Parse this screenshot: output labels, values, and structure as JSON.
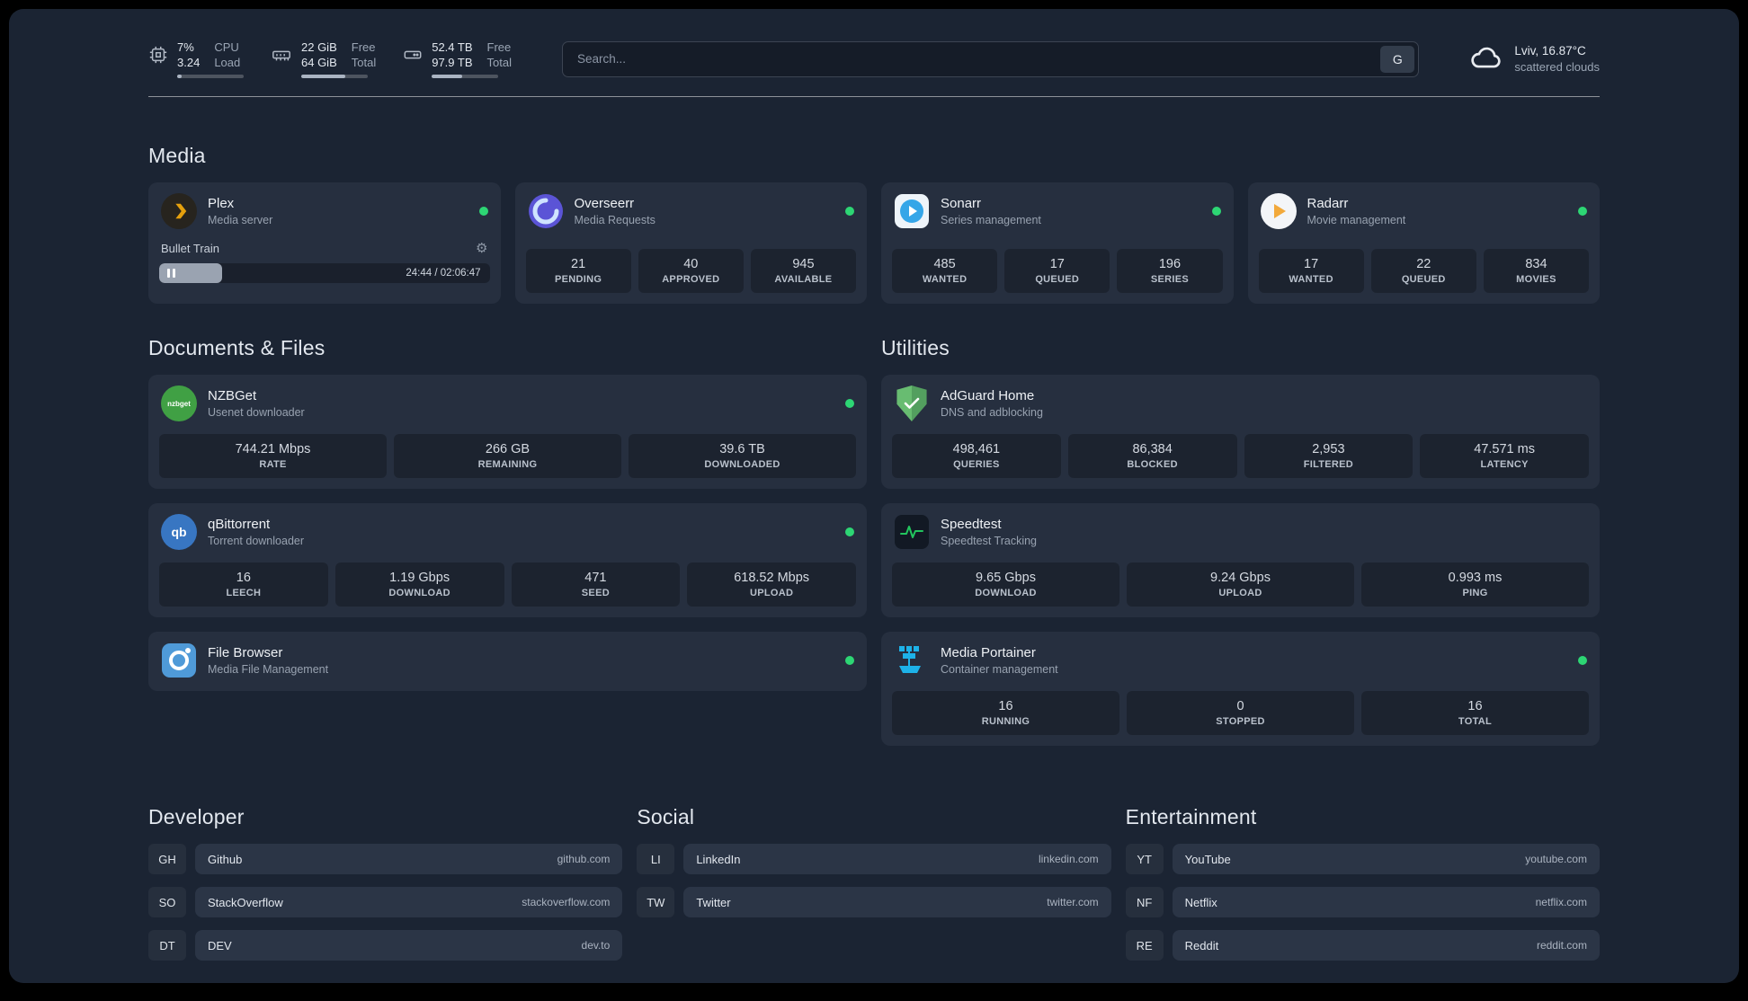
{
  "topbar": {
    "resources": [
      {
        "icon": "cpu-icon",
        "value_top": "7%",
        "value_bottom": "3.24",
        "label_top": "CPU",
        "label_bottom": "Load",
        "progress": 7
      },
      {
        "icon": "memory-icon",
        "value_top": "22 GiB",
        "value_bottom": "64 GiB",
        "label_top": "Free",
        "label_bottom": "Total",
        "progress": 66
      },
      {
        "icon": "disk-icon",
        "value_top": "52.4 TB",
        "value_bottom": "97.9 TB",
        "label_top": "Free",
        "label_bottom": "Total",
        "progress": 46
      }
    ],
    "search": {
      "placeholder": "Search...",
      "provider_label": "G"
    },
    "weather": {
      "location": "Lviv, 16.87°C",
      "condition": "scattered clouds"
    }
  },
  "groups": {
    "media": {
      "title": "Media",
      "plex": {
        "name": "Plex",
        "desc": "Media server",
        "player_title": "Bullet Train",
        "player_time": "24:44 / 02:06:47",
        "player_progress": 19
      },
      "overseerr": {
        "name": "Overseerr",
        "desc": "Media Requests",
        "stats": [
          {
            "value": "21",
            "label": "PENDING"
          },
          {
            "value": "40",
            "label": "APPROVED"
          },
          {
            "value": "945",
            "label": "AVAILABLE"
          }
        ]
      },
      "sonarr": {
        "name": "Sonarr",
        "desc": "Series management",
        "stats": [
          {
            "value": "485",
            "label": "WANTED"
          },
          {
            "value": "17",
            "label": "QUEUED"
          },
          {
            "value": "196",
            "label": "SERIES"
          }
        ]
      },
      "radarr": {
        "name": "Radarr",
        "desc": "Movie management",
        "stats": [
          {
            "value": "17",
            "label": "WANTED"
          },
          {
            "value": "22",
            "label": "QUEUED"
          },
          {
            "value": "834",
            "label": "MOVIES"
          }
        ]
      }
    },
    "documents": {
      "title": "Documents & Files",
      "nzbget": {
        "name": "NZBGet",
        "desc": "Usenet downloader",
        "icon_text": "nzbget",
        "stats": [
          {
            "value": "744.21 Mbps",
            "label": "RATE"
          },
          {
            "value": "266 GB",
            "label": "REMAINING"
          },
          {
            "value": "39.6 TB",
            "label": "DOWNLOADED"
          }
        ]
      },
      "qbittorrent": {
        "name": "qBittorrent",
        "desc": "Torrent downloader",
        "icon_text": "qb",
        "stats": [
          {
            "value": "16",
            "label": "LEECH"
          },
          {
            "value": "1.19 Gbps",
            "label": "DOWNLOAD"
          },
          {
            "value": "471",
            "label": "SEED"
          },
          {
            "value": "618.52 Mbps",
            "label": "UPLOAD"
          }
        ]
      },
      "filebrowser": {
        "name": "File Browser",
        "desc": "Media File Management"
      }
    },
    "utilities": {
      "title": "Utilities",
      "adguard": {
        "name": "AdGuard Home",
        "desc": "DNS and adblocking",
        "stats": [
          {
            "value": "498,461",
            "label": "QUERIES"
          },
          {
            "value": "86,384",
            "label": "BLOCKED"
          },
          {
            "value": "2,953",
            "label": "FILTERED"
          },
          {
            "value": "47.571 ms",
            "label": "LATENCY"
          }
        ]
      },
      "speedtest": {
        "name": "Speedtest",
        "desc": "Speedtest Tracking",
        "stats": [
          {
            "value": "9.65 Gbps",
            "label": "DOWNLOAD"
          },
          {
            "value": "9.24 Gbps",
            "label": "UPLOAD"
          },
          {
            "value": "0.993 ms",
            "label": "PING"
          }
        ]
      },
      "portainer": {
        "name": "Media Portainer",
        "desc": "Container management",
        "stats": [
          {
            "value": "16",
            "label": "RUNNING"
          },
          {
            "value": "0",
            "label": "STOPPED"
          },
          {
            "value": "16",
            "label": "TOTAL"
          }
        ]
      }
    }
  },
  "bookmarks": [
    {
      "title": "Developer",
      "items": [
        {
          "abbr": "GH",
          "label": "Github",
          "url": "github.com"
        },
        {
          "abbr": "SO",
          "label": "StackOverflow",
          "url": "stackoverflow.com"
        },
        {
          "abbr": "DT",
          "label": "DEV",
          "url": "dev.to"
        }
      ]
    },
    {
      "title": "Social",
      "items": [
        {
          "abbr": "LI",
          "label": "LinkedIn",
          "url": "linkedin.com"
        },
        {
          "abbr": "TW",
          "label": "Twitter",
          "url": "twitter.com"
        }
      ]
    },
    {
      "title": "Entertainment",
      "items": [
        {
          "abbr": "YT",
          "label": "YouTube",
          "url": "youtube.com"
        },
        {
          "abbr": "NF",
          "label": "Netflix",
          "url": "netflix.com"
        },
        {
          "abbr": "RE",
          "label": "Reddit",
          "url": "reddit.com"
        }
      ]
    }
  ]
}
